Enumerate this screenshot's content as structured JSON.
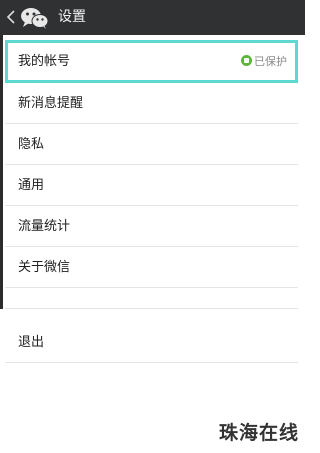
{
  "header": {
    "title": "设置",
    "back_icon": "chevron-left-icon",
    "app_icon": "wechat-icon"
  },
  "settings": {
    "items": [
      {
        "label": "我的帐号",
        "badge": "已保护",
        "badge_icon": "lock-icon"
      },
      {
        "label": "新消息提醒"
      },
      {
        "label": "隐私"
      },
      {
        "label": "通用"
      },
      {
        "label": "流量统计"
      },
      {
        "label": "关于微信"
      }
    ],
    "logout_label": "退出"
  },
  "watermark": {
    "text": "珠海在线"
  },
  "colors": {
    "titlebar": "#2f3133",
    "selection_outline": "#5ed9d1",
    "badge_lock": "#5bb53b"
  }
}
